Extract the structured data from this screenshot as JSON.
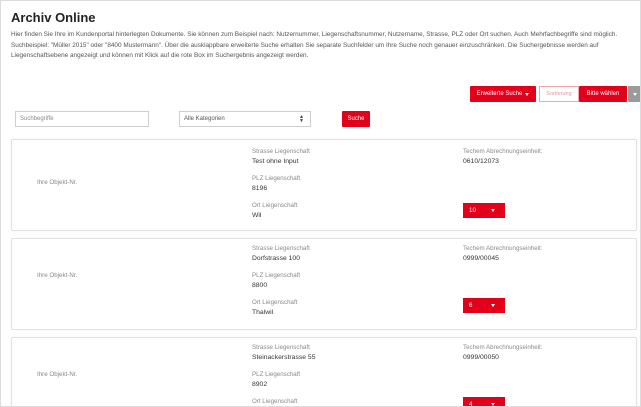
{
  "page": {
    "title": "Archiv Online",
    "intro": "Hier finden Sie Ihre im Kundenportal hinterlegten Dokumente. Sie können zum Beispiel nach: Nutzernummer, Liegenschaftsnummer, Nutzername, Strasse, PLZ oder Ort suchen. Auch Mehrfachbegriffe sind möglich. Suchbeispiel: \"Müller 2015\" oder \"8400 Mustermann\". Über die ausklappbare erweiterte Suche erhalten Sie separate Suchfelder um Ihre Suche noch genauer einzuschränken. Die Suchergebnisse werden auf Liegenschaftsebene angezeigt und können mit Klick auf die rote Box im Suchergebnis angezeigt werden."
  },
  "toolbar": {
    "extended_search_label": "Erweiterte Suche",
    "sort_label": "Sortierung",
    "choose_label": "Bitte wählen"
  },
  "search": {
    "placeholder": "Suchbegriffe",
    "category_value": "Alle Kategorien",
    "button_label": "Suche"
  },
  "labels": {
    "object_nr": "Ihre Objekt-Nr.",
    "street": "Strasse Liegenschaft",
    "zip": "PLZ Liegenschaft",
    "city": "Ort Liegenschaft",
    "billing_unit": "Techem Abrechnungseinheit:"
  },
  "results": [
    {
      "street": "Test ohne Input",
      "zip": "8196",
      "city": "Wil",
      "billing_unit": "0610/12073",
      "count": "10"
    },
    {
      "street": "Dorfstrasse 100",
      "zip": "8800",
      "city": "Thalwil",
      "billing_unit": "0999/00045",
      "count": "6"
    },
    {
      "street": "Steinackerstrasse 55",
      "zip": "8902",
      "city": "",
      "billing_unit": "0999/00050",
      "count": "4"
    }
  ],
  "colors": {
    "accent": "#e2001a",
    "muted_button": "#9a9a9a"
  }
}
